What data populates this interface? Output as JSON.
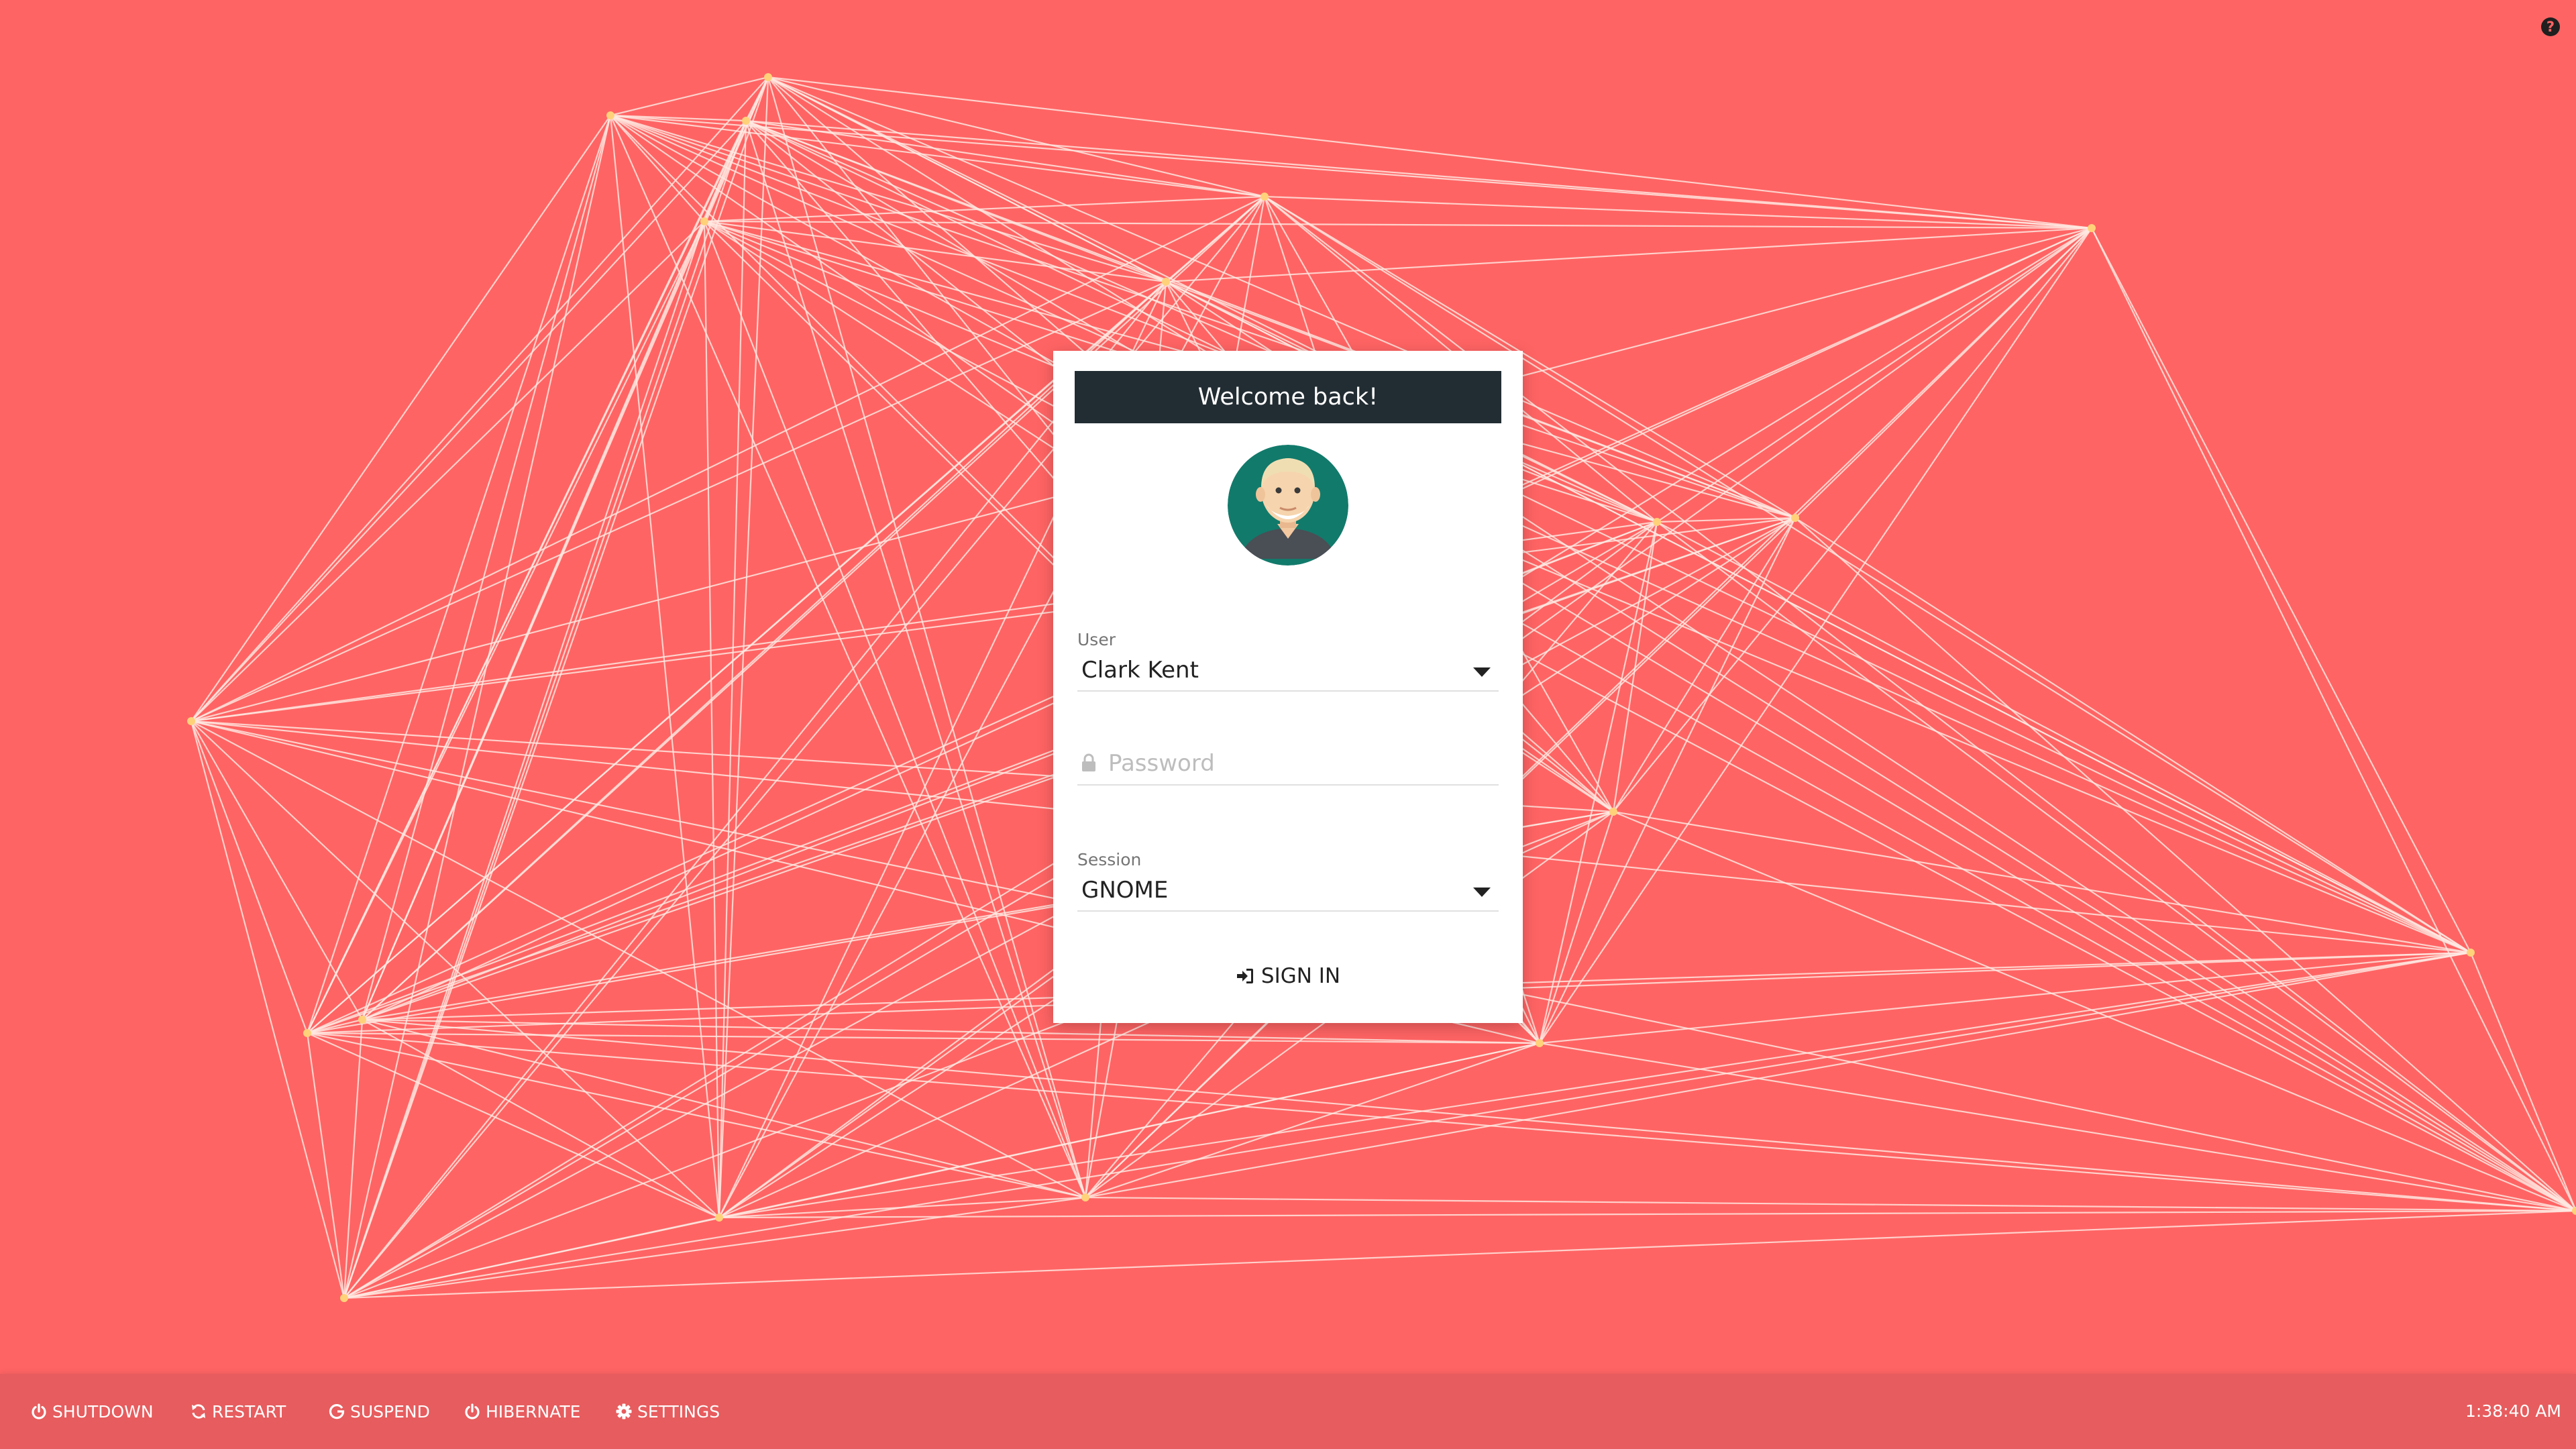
{
  "theme": {
    "background": "#ff6464",
    "bottom_bar": "#e75c5e",
    "header_bg": "#222d33",
    "network_line": "#ffe9e2",
    "network_node": "#ffd27a"
  },
  "greeter": {
    "title": "Welcome back!",
    "avatar_icon": "user-avatar-icon",
    "user_label": "User",
    "user_value": "Clark Kent",
    "password_placeholder": "Password",
    "password_value": "",
    "session_label": "Session",
    "session_value": "GNOME",
    "sign_in_label": "SIGN IN"
  },
  "help": {
    "icon": "question-icon",
    "label": "?"
  },
  "actions": [
    {
      "label": "SHUTDOWN",
      "icon": "power-icon"
    },
    {
      "label": "RESTART",
      "icon": "refresh-icon"
    },
    {
      "label": "SUSPEND",
      "icon": "suspend-icon"
    },
    {
      "label": "HIBERNATE",
      "icon": "power-icon"
    },
    {
      "label": "SETTINGS",
      "icon": "gear-icon"
    }
  ],
  "clock": "1:38:40 AM"
}
